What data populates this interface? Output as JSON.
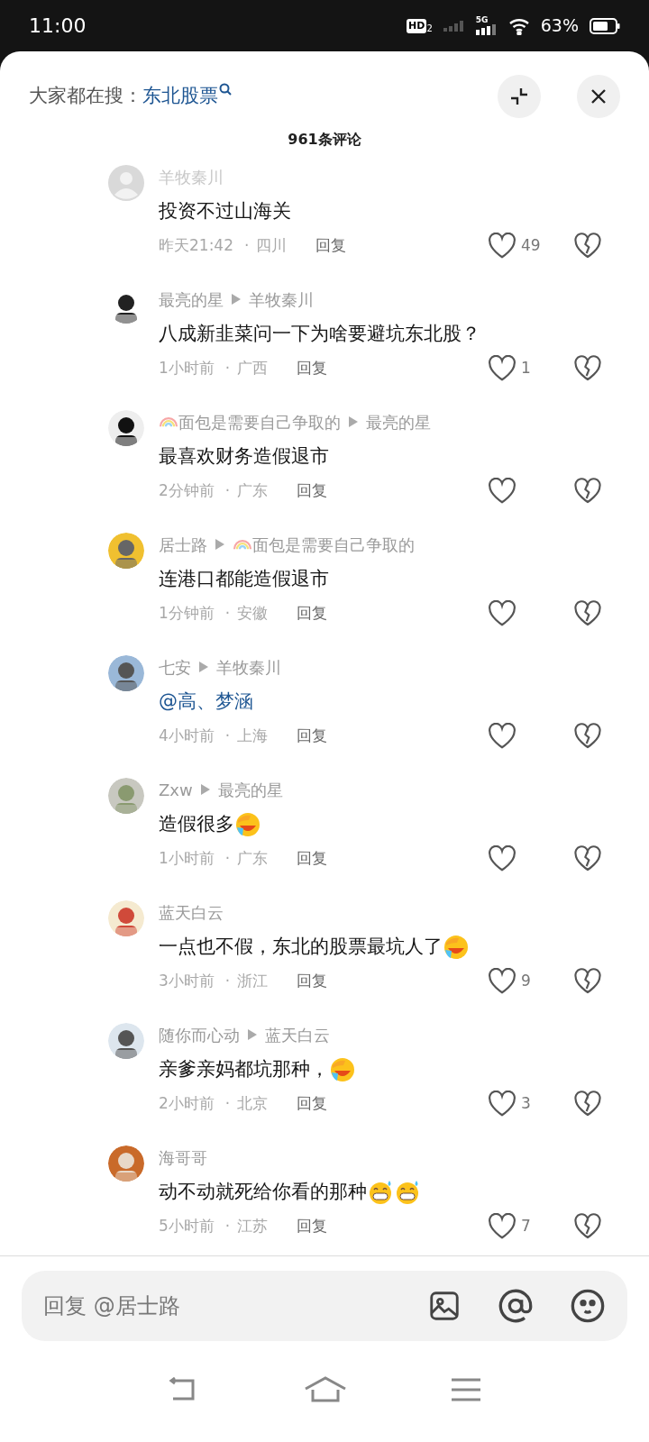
{
  "status_bar": {
    "time": "11:00",
    "hd": "HD",
    "hd_sub": "2",
    "network": "5G",
    "battery": "63%"
  },
  "header": {
    "search_label": "大家都在搜：",
    "search_term": "东北股票"
  },
  "comment_count": "961条评论",
  "comments": [
    {
      "avatar": {
        "kind": "default"
      },
      "author": "羊牧秦川",
      "text": "投资不过山海关",
      "time": "昨天21:42",
      "separator": "·",
      "place": "四川",
      "reply": "回复",
      "likes": "49"
    },
    {
      "avatar": {
        "kind": "picture"
      },
      "author": "最亮的星",
      "reply_to": "羊牧秦川",
      "text": "八成新韭菜问一下为啥要避坑东北股？",
      "time": "1小时前",
      "separator": "·",
      "place": "广西",
      "reply": "回复",
      "likes": "1"
    },
    {
      "avatar": {
        "kind": "picture"
      },
      "author": "面包是需要自己争取的",
      "author_badge": {
        "kind": "rainbow"
      },
      "reply_to": "最亮的星",
      "text": "最喜欢财务造假退市",
      "time": "2分钟前",
      "separator": "·",
      "place": "广东",
      "reply": "回复"
    },
    {
      "avatar": {
        "kind": "picture"
      },
      "author": "居士路",
      "reply_to": "面包是需要自己争取的",
      "reply_to_badge": {
        "kind": "rainbow"
      },
      "text": "连港口都能造假退市",
      "time": "1分钟前",
      "separator": "·",
      "place": "安徽",
      "reply": "回复"
    },
    {
      "avatar": {
        "kind": "picture"
      },
      "author": "七安",
      "reply_to": "羊牧秦川",
      "mention": "@高、梦涵",
      "time": "4小时前",
      "separator": "·",
      "place": "上海",
      "reply": "回复"
    },
    {
      "avatar": {
        "kind": "picture"
      },
      "author": "Zxw",
      "reply_to": "最亮的星",
      "text": "造假很多",
      "emojis": [
        {
          "kind": "cry-laugh"
        }
      ],
      "time": "1小时前",
      "separator": "·",
      "place": "广东",
      "reply": "回复"
    },
    {
      "avatar": {
        "kind": "picture"
      },
      "author": "蓝天白云",
      "text": "一点也不假，东北的股票最坑人了",
      "emojis": [
        {
          "kind": "cry-laugh"
        }
      ],
      "time": "3小时前",
      "separator": "·",
      "place": "浙江",
      "reply": "回复",
      "likes": "9"
    },
    {
      "avatar": {
        "kind": "picture"
      },
      "author": "随你而心动",
      "reply_to": "蓝天白云",
      "text": "亲爹亲妈都坑那种，",
      "emojis": [
        {
          "kind": "cry-laugh"
        }
      ],
      "time": "2小时前",
      "separator": "·",
      "place": "北京",
      "reply": "回复",
      "likes": "3"
    },
    {
      "avatar": {
        "kind": "picture"
      },
      "author": "海哥哥",
      "text": "动不动就死给你看的那种",
      "emojis": [
        {
          "kind": "grin-sweat"
        },
        {
          "kind": "grin-sweat"
        }
      ],
      "time": "5小时前",
      "separator": "·",
      "place": "江苏",
      "reply": "回复",
      "likes": "7"
    }
  ],
  "input": {
    "placeholder": "回复 @居士路"
  }
}
